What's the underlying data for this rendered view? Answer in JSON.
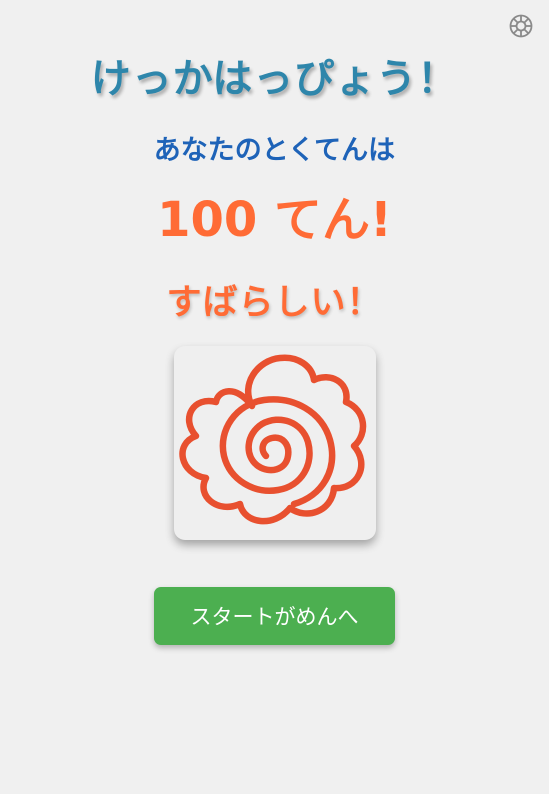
{
  "result_screen": {
    "title": "けっかはっぴょう！",
    "score_label": "あなたのとくてんは",
    "score_text": "100 てん!",
    "praise": "すばらしい！",
    "start_button_label": "スタートがめんへ"
  },
  "icons": {
    "settings": "gear-icon",
    "reward_stamp": "hanamaru-flower-stamp-icon"
  },
  "colors": {
    "title": "#2e86ab",
    "score_label": "#1e63b8",
    "score": "#ff6b35",
    "praise": "#ff6b35",
    "stamp": "#e8502f",
    "button": "#4caf50",
    "background": "#f0f0f0"
  }
}
